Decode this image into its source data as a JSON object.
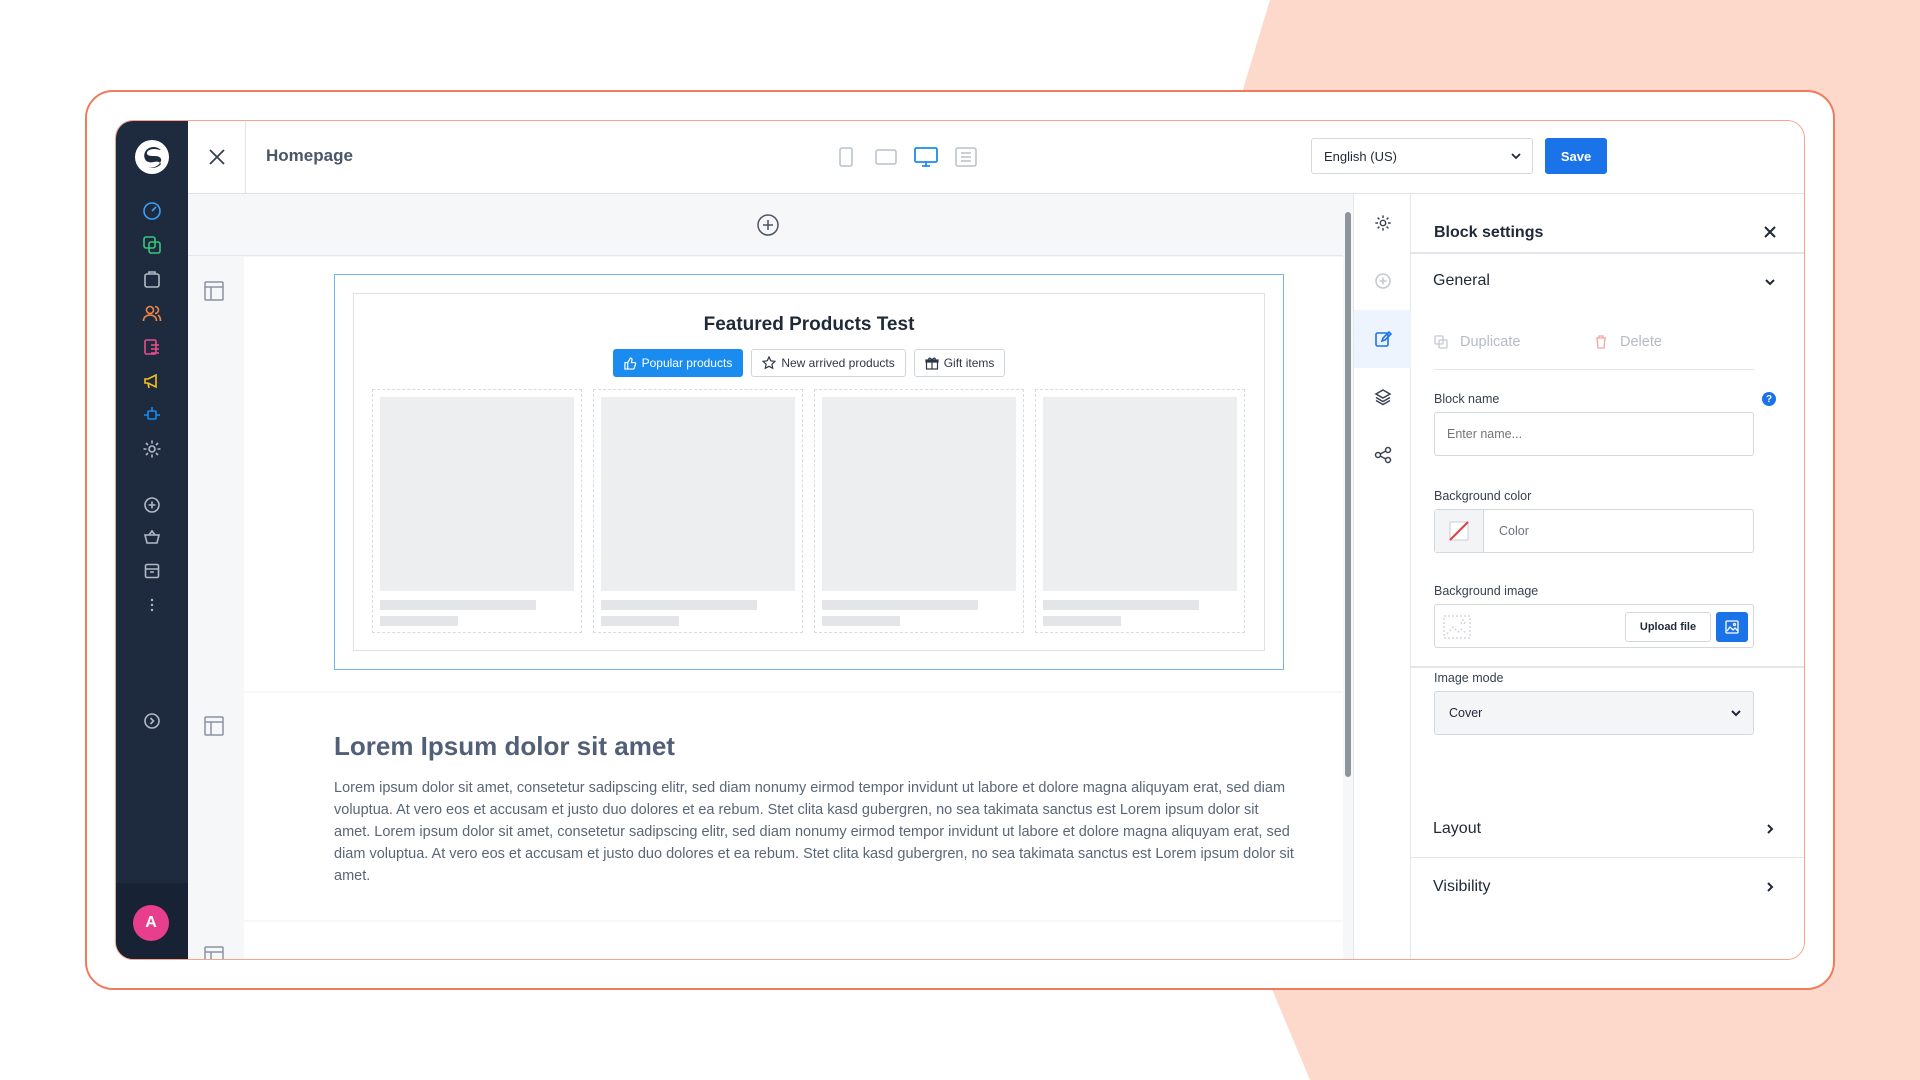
{
  "page": {
    "title": "Homepage"
  },
  "nav": {
    "avatar_initial": "A"
  },
  "topbar": {
    "language": "English (US)",
    "save_label": "Save",
    "viewports": [
      "mobile",
      "tablet",
      "desktop",
      "list"
    ],
    "active_viewport": "desktop"
  },
  "canvas": {
    "block1": {
      "title": "Featured Products Test",
      "tabs": [
        {
          "label": "Popular products",
          "icon": "thumbs-up-icon",
          "active": true
        },
        {
          "label": "New arrived products",
          "icon": "star-icon",
          "active": false
        },
        {
          "label": "Gift items",
          "icon": "gift-icon",
          "active": false
        }
      ],
      "product_placeholders": 4
    },
    "block2": {
      "heading": "Lorem Ipsum dolor sit amet",
      "body": "Lorem ipsum dolor sit amet, consetetur sadipscing elitr, sed diam nonumy eirmod tempor invidunt ut labore et dolore magna aliquyam erat, sed diam voluptua. At vero eos et accusam et justo duo dolores et ea rebum. Stet clita kasd gubergren, no sea takimata sanctus est Lorem ipsum dolor sit amet. Lorem ipsum dolor sit amet, consetetur sadipscing elitr, sed diam nonumy eirmod tempor invidunt ut labore et dolore magna aliquyam erat, sed diam voluptua. At vero eos et accusam et justo duo dolores et ea rebum. Stet clita kasd gubergren, no sea takimata sanctus est Lorem ipsum dolor sit amet."
    }
  },
  "panel": {
    "title": "Block settings",
    "general": {
      "label": "General",
      "duplicate_label": "Duplicate",
      "delete_label": "Delete",
      "block_name_label": "Block name",
      "block_name_placeholder": "Enter name...",
      "bg_color_label": "Background color",
      "bg_color_placeholder": "Color",
      "bg_image_label": "Background image",
      "upload_label": "Upload file",
      "image_mode_label": "Image mode",
      "image_mode_value": "Cover"
    },
    "layout_label": "Layout",
    "visibility_label": "Visibility"
  },
  "colors": {
    "accent": "#1a73e8",
    "nav_bg": "#1e2b3f",
    "frame_border": "#ef7b5b",
    "blob": "#fdd9cc",
    "avatar": "#e83f8c"
  }
}
